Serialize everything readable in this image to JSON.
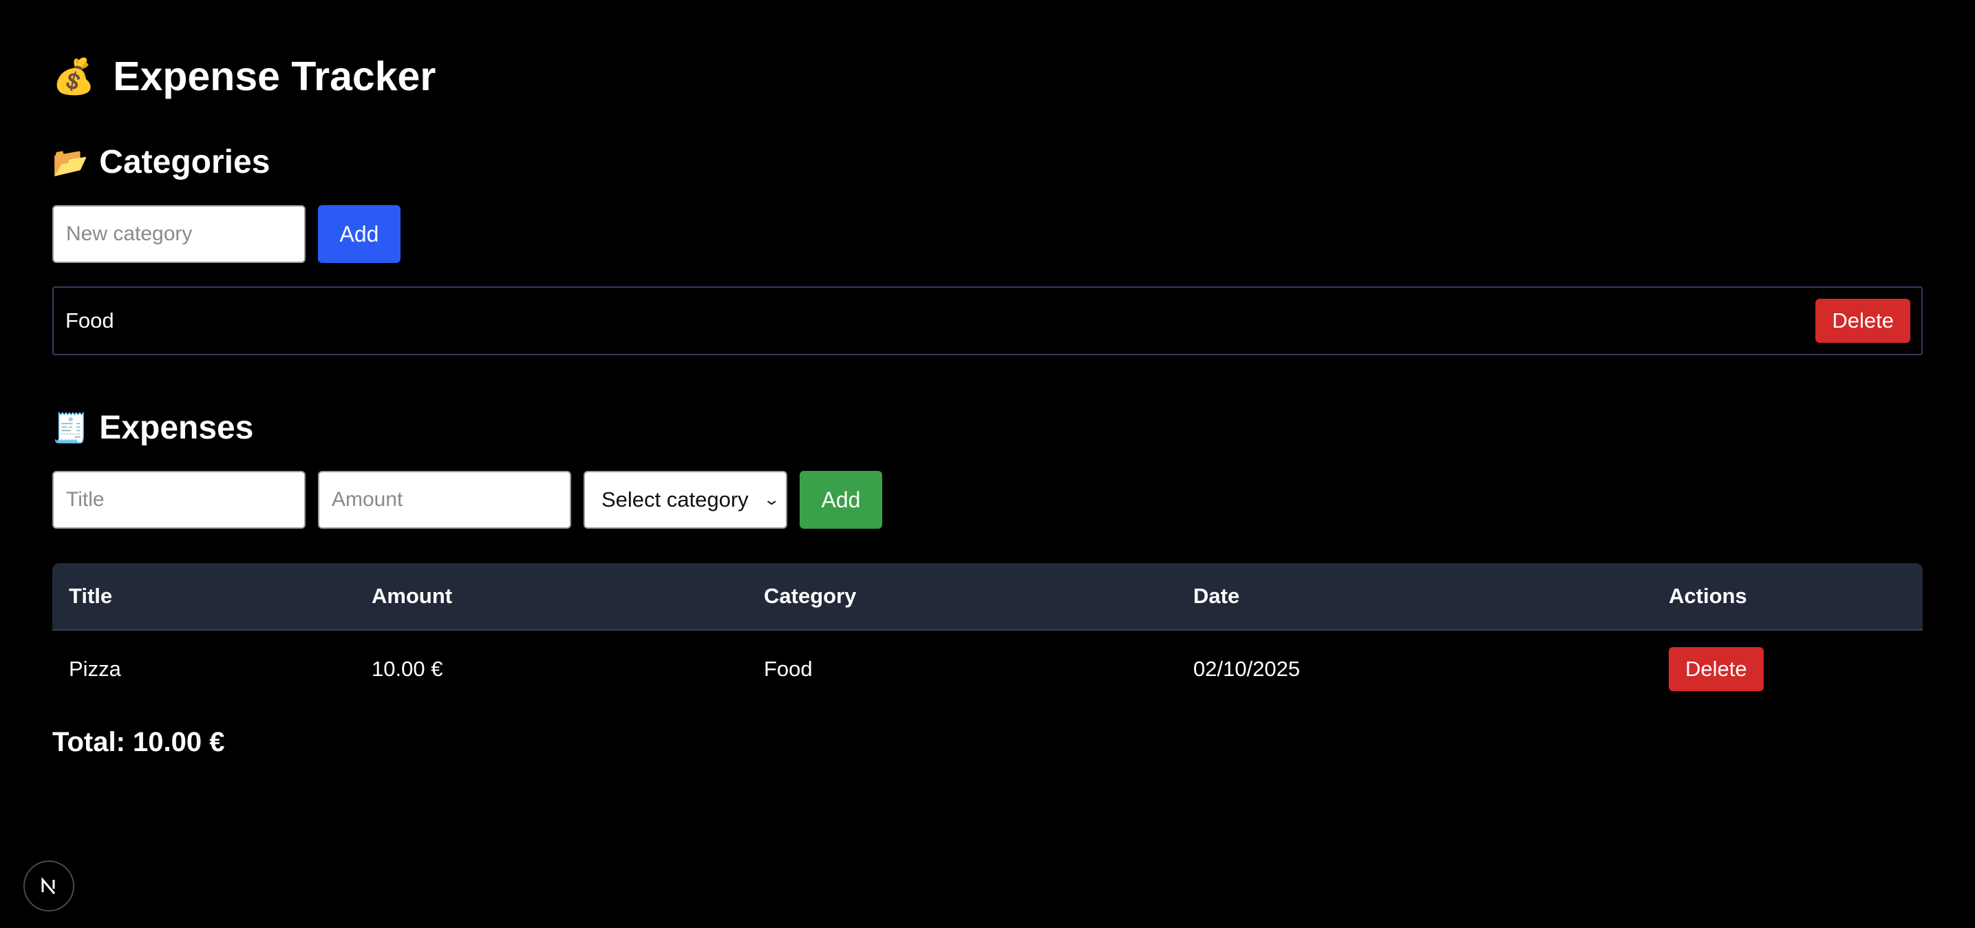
{
  "header": {
    "icon": "money-bag-icon",
    "title": "Expense Tracker"
  },
  "categories": {
    "icon": "folder-icon",
    "heading": "Categories",
    "input_placeholder": "New category",
    "add_label": "Add",
    "items": [
      {
        "name": "Food",
        "delete_label": "Delete"
      }
    ]
  },
  "expenses": {
    "icon": "receipt-icon",
    "heading": "Expenses",
    "title_placeholder": "Title",
    "amount_placeholder": "Amount",
    "category_select_value": "Select category",
    "add_label": "Add",
    "table": {
      "columns": [
        "Title",
        "Amount",
        "Category",
        "Date",
        "Actions"
      ],
      "rows": [
        {
          "title": "Pizza",
          "amount": "10.00 €",
          "category": "Food",
          "date": "02/10/2025",
          "action_label": "Delete"
        }
      ]
    },
    "total_text": "Total: 10.00 €"
  },
  "colors": {
    "background": "#000000",
    "add_category_button": "#2b5bf5",
    "add_expense_button": "#3aa04a",
    "delete_button": "#d42a2a",
    "table_header": "#222938"
  },
  "dev_badge": {
    "icon": "nextjs-logo-icon"
  }
}
